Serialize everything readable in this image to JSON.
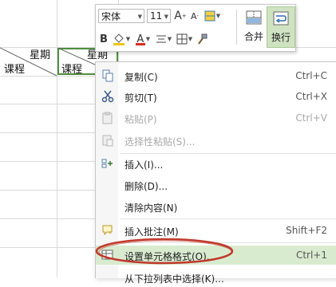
{
  "sheet": {
    "cell_a_top": "星期",
    "cell_a_bottom": "课程",
    "cell_b_top": "星期",
    "cell_b_bottom": "课程"
  },
  "minibar": {
    "font_name": "宋体",
    "font_size": "11",
    "increase_font": "A",
    "decrease_font": "A",
    "bold": "B",
    "font_color_letter": "A",
    "merge_label": "合并",
    "wrap_label": "换行",
    "accent_color": "#4e8f3e"
  },
  "context_menu": {
    "items": [
      {
        "label": "复制(C)",
        "shortcut": "Ctrl+C",
        "icon": "copy-icon"
      },
      {
        "label": "剪切(T)",
        "shortcut": "Ctrl+X",
        "icon": "scissors-icon"
      },
      {
        "label": "粘贴(P)",
        "shortcut": "Ctrl+V",
        "icon": "paste-icon"
      },
      {
        "label": "选择性粘贴(S)...",
        "shortcut": "",
        "icon": "paste-special-icon"
      },
      {
        "label": "插入(I)...",
        "shortcut": "",
        "icon": "insert-icon"
      },
      {
        "label": "删除(D)...",
        "shortcut": "",
        "icon": ""
      },
      {
        "label": "清除内容(N)",
        "shortcut": "",
        "icon": ""
      },
      {
        "label": "插入批注(M)",
        "shortcut": "Shift+F2",
        "icon": "comment-icon"
      },
      {
        "label": "设置单元格格式(O)...",
        "shortcut": "Ctrl+1",
        "icon": "format-cells-icon"
      },
      {
        "label": "从下拉列表中选择(K)...",
        "shortcut": "",
        "icon": ""
      }
    ],
    "highlight_color": "#d9ebcf",
    "annotation_color": "#c0392b"
  }
}
